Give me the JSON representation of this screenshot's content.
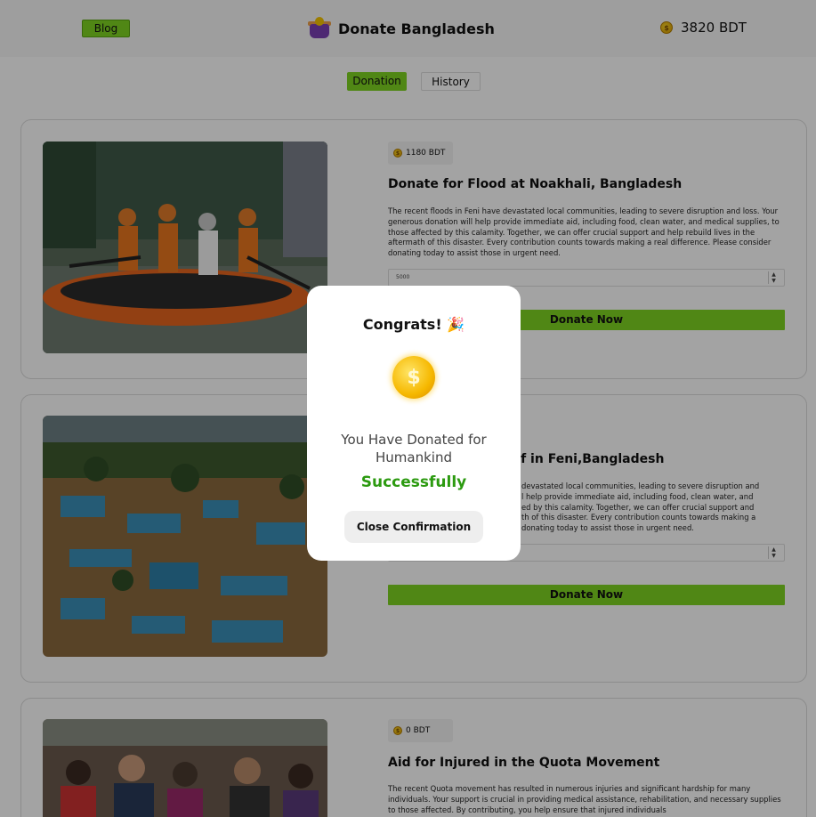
{
  "header": {
    "blog_label": "Blog",
    "brand_name": "Donate Bangladesh",
    "balance": "3820 BDT",
    "logo_icon": "donation-jar-icon",
    "coin_icon": "coin-icon"
  },
  "tabs": [
    {
      "label": "Donation",
      "active": true
    },
    {
      "label": "History",
      "active": false
    }
  ],
  "cards": [
    {
      "amount": "1180 BDT",
      "title": "Donate for Flood at Noakhali, Bangladesh",
      "description": "The recent floods in Feni have devastated local communities, leading to severe disruption and loss. Your generous donation will help provide immediate aid, including food, clean water, and medical supplies, to those affected by this calamity. Together, we can offer crucial support and help rebuild lives in the aftermath of this disaster. Every contribution counts towards making a real difference. Please consider donating today to assist those in urgent need.",
      "input_value": "5000",
      "button_label": "Donate Now",
      "image_subject": "rescue-boat-flood-photo"
    },
    {
      "amount": "",
      "title": "Donate for Flood Relief in Feni,Bangladesh",
      "visible_title": "lief in Feni,Bangladesh",
      "description": "The recent floods in Feni have devastated local communities, leading to severe disruption and loss. Your generous donation will help provide immediate aid, including food, clean water, and medical supplies, to those affected by this calamity. Together, we can offer crucial support and help rebuild lives in the aftermath of this disaster. Every contribution counts towards making a real difference. Please consider donating today to assist those in urgent need.",
      "visible_desc_lines": [
        "devastated local communities, leading to severe disruption and",
        "l help provide immediate aid, including food, clean water, and",
        "ed by this calamity. Together, we can offer crucial support and",
        "th of this disaster. Every contribution counts towards making a",
        "donating today to assist those in urgent need."
      ],
      "input_value": "",
      "button_label": "Donate Now",
      "image_subject": "aerial-flooded-town-photo"
    },
    {
      "amount": "0 BDT",
      "title": "Aid for Injured in the Quota Movement",
      "description": "The recent Quota movement has resulted in numerous injuries and significant hardship for many individuals. Your support is crucial in providing medical assistance, rehabilitation, and necessary supplies to those affected. By contributing, you help ensure that injured individuals",
      "image_subject": "crowd-protest-photo"
    }
  ],
  "modal": {
    "title": "Congrats! 🎉",
    "message": "You Have Donated for Humankind",
    "status": "Successfully",
    "close_label": "Close Confirmation",
    "coin_icon": "gold-coin-icon"
  },
  "colors": {
    "accent": "#7ed321",
    "success": "#2c9a10",
    "overlay": "rgba(0,0,0,0.36)"
  }
}
